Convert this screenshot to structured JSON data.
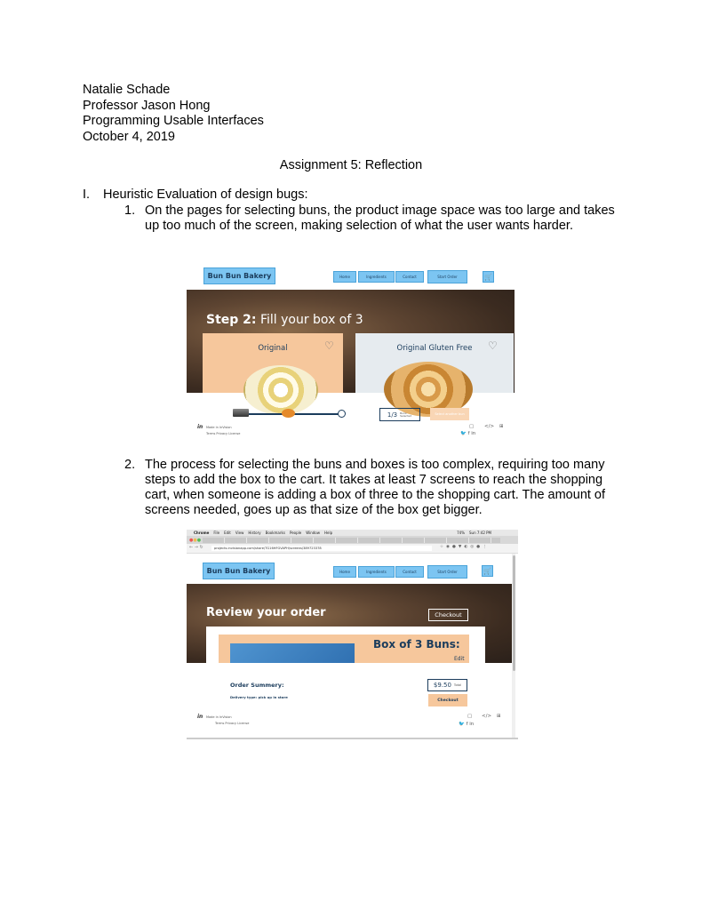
{
  "header": {
    "author": "Natalie Schade",
    "professor": "Professor Jason Hong",
    "course": "Programming Usable Interfaces",
    "date": "October 4, 2019"
  },
  "title": "Assignment 5: Reflection",
  "section": {
    "numeral": "I.",
    "heading": "Heuristic Evaluation of design bugs:"
  },
  "items": [
    {
      "num": "1.",
      "text": "On the pages for selecting buns, the product image space was too large and takes up too much of the screen, making selection of what the user wants harder."
    },
    {
      "num": "2.",
      "text": "The process for selecting the buns and boxes is too complex, requiring too many steps to add the box to the cart. It takes at least 7 screens to reach the shopping cart, when someone is adding a box of three to the shopping cart. The amount of screens needed, goes up as that size of the box get bigger."
    }
  ],
  "shot1": {
    "logo": "Bun Bun Bakery",
    "nav": [
      "Home",
      "Ingredients",
      "Contact",
      "Start Order"
    ],
    "hero_step": "Step 2:",
    "hero_rest": " Fill your box of 3",
    "card1": "Original",
    "card2": "Original Gluten Free",
    "counter": "1/3",
    "counter_sub": "Buns Selected",
    "select_btn": "Select another bun",
    "made_in": "Made in InVision",
    "footer_links": "Terms   Privacy   License"
  },
  "shot2": {
    "menubar": [
      "Chrome",
      "File",
      "Edit",
      "View",
      "History",
      "Bookmarks",
      "People",
      "Window",
      "Help"
    ],
    "clock": "Sun 7:42 PM",
    "battery": "74%",
    "url": "projects.invisionapp.com/share/TG16HFGVAPH/screens/389723378",
    "logo": "Bun Bun Bakery",
    "nav": [
      "Home",
      "Ingredients",
      "Contact",
      "Start Order"
    ],
    "hero_title": "Review your order",
    "checkout_top": "Checkout",
    "box_title": "Box of 3 Buns:",
    "edit": "Edit",
    "summary_title": "Order Summery:",
    "delivery": "Delivery type: pick up in store",
    "price": "$9.50",
    "total": "Total",
    "checkout_btn": "Checkout",
    "made_in": "Made in InVision",
    "footer_links": "Terms   Privacy   License"
  },
  "colors": {
    "accent_blue": "#7cc5f2",
    "peach": "#f6c79c",
    "navy": "#1b3c5c"
  }
}
